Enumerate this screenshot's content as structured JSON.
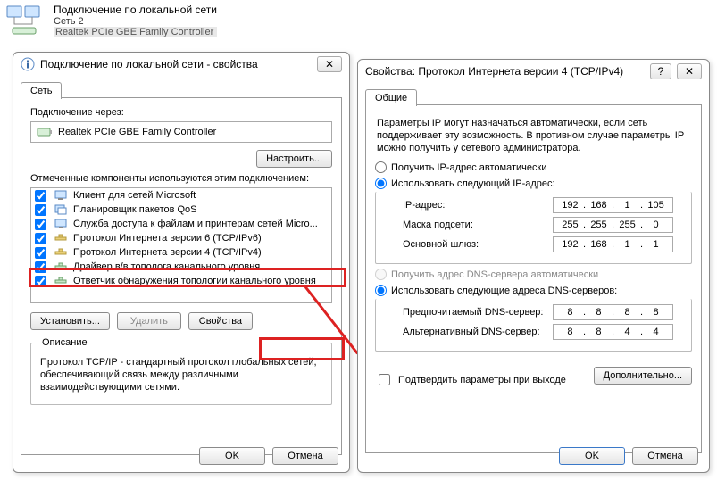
{
  "header": {
    "title": "Подключение по локальной сети",
    "subtitle": "Сеть 2",
    "adapter": "Realtek PCIe GBE Family Controller"
  },
  "left_dialog": {
    "title": "Подключение по локальной сети - свойства",
    "tab": "Сеть",
    "connect_via_label": "Подключение через:",
    "adapter_name": "Realtek PCIe GBE Family Controller",
    "configure_btn": "Настроить...",
    "components_label": "Отмеченные компоненты используются этим подключением:",
    "components": [
      {
        "checked": true,
        "label": "Клиент для сетей Microsoft"
      },
      {
        "checked": true,
        "label": "Планировщик пакетов QoS"
      },
      {
        "checked": true,
        "label": "Служба доступа к файлам и принтерам сетей Micro..."
      },
      {
        "checked": true,
        "label": "Протокол Интернета версии 6 (TCP/IPv6)"
      },
      {
        "checked": true,
        "label": "Протокол Интернета версии 4 (TCP/IPv4)"
      },
      {
        "checked": true,
        "label": "Драйвер в/в тополога канального уровня"
      },
      {
        "checked": true,
        "label": "Ответчик обнаружения топологии канального уровня"
      }
    ],
    "install_btn": "Установить...",
    "uninstall_btn": "Удалить",
    "properties_btn": "Свойства",
    "description_legend": "Описание",
    "description_text": "Протокол TCP/IP - стандартный протокол глобальных сетей, обеспечивающий связь между различными взаимодействующими сетями.",
    "ok_btn": "OK",
    "cancel_btn": "Отмена"
  },
  "right_dialog": {
    "title": "Свойства: Протокол Интернета версии 4 (TCP/IPv4)",
    "tab": "Общие",
    "info_text": "Параметры IP могут назначаться автоматически, если сеть поддерживает эту возможность. В противном случае параметры IP можно получить у сетевого администратора.",
    "radio_auto_ip": "Получить IP-адрес автоматически",
    "radio_manual_ip": "Использовать следующий IP-адрес:",
    "ip_label": "IP-адрес:",
    "ip_value": [
      "192",
      "168",
      "1",
      "105"
    ],
    "mask_label": "Маска подсети:",
    "mask_value": [
      "255",
      "255",
      "255",
      "0"
    ],
    "gateway_label": "Основной шлюз:",
    "gateway_value": [
      "192",
      "168",
      "1",
      "1"
    ],
    "radio_auto_dns": "Получить адрес DNS-сервера автоматически",
    "radio_manual_dns": "Использовать следующие адреса DNS-серверов:",
    "dns1_label": "Предпочитаемый DNS-сервер:",
    "dns1_value": [
      "8",
      "8",
      "8",
      "8"
    ],
    "dns2_label": "Альтернативный DNS-сервер:",
    "dns2_value": [
      "8",
      "8",
      "4",
      "4"
    ],
    "confirm_on_exit": "Подтвердить параметры при выходе",
    "advanced_btn": "Дополнительно...",
    "ok_btn": "OK",
    "cancel_btn": "Отмена"
  }
}
